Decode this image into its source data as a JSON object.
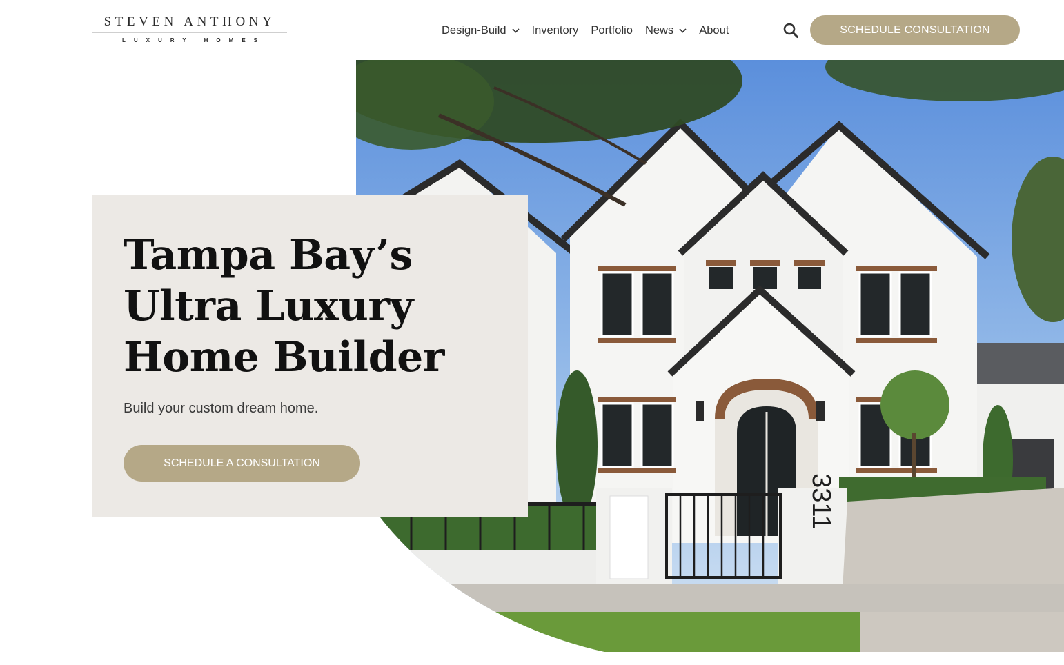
{
  "logo": {
    "name": "STEVEN ANTHONY",
    "tagline": "LUXURY HOMES"
  },
  "nav": {
    "items": [
      {
        "label": "Design-Build",
        "has_dropdown": true
      },
      {
        "label": "Inventory",
        "has_dropdown": false
      },
      {
        "label": "Portfolio",
        "has_dropdown": false
      },
      {
        "label": "News",
        "has_dropdown": true
      },
      {
        "label": "About",
        "has_dropdown": false
      }
    ],
    "search_icon": "search-icon",
    "cta_label": "SCHEDULE CONSULTATION"
  },
  "hero": {
    "title": "Tampa Bay’s Ultra Luxury Home Builder",
    "subtitle": "Build your custom dream home.",
    "cta_label": "SCHEDULE A CONSULTATION",
    "image": {
      "house_number": "3311"
    }
  },
  "colors": {
    "accent": "#b5a887",
    "card_background": "#ece9e5",
    "text_dark": "#111111"
  }
}
